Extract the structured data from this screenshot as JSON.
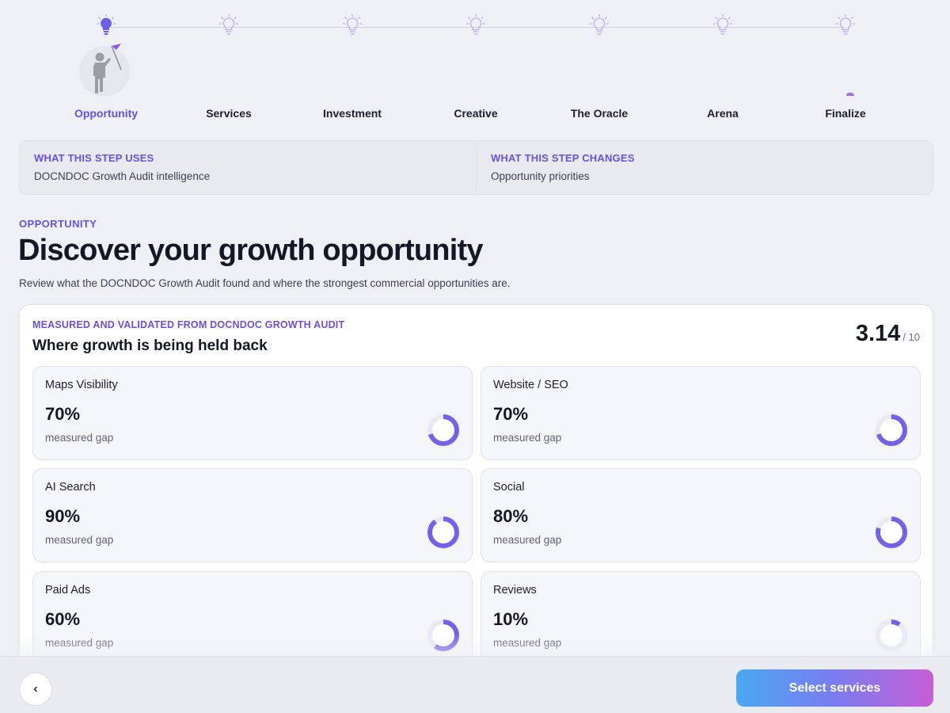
{
  "steps": [
    {
      "label": "Opportunity",
      "active": true
    },
    {
      "label": "Services",
      "active": false
    },
    {
      "label": "Investment",
      "active": false
    },
    {
      "label": "Creative",
      "active": false
    },
    {
      "label": "The Oracle",
      "active": false
    },
    {
      "label": "Arena",
      "active": false
    },
    {
      "label": "Finalize",
      "active": false
    }
  ],
  "info": {
    "uses_key": "WHAT THIS STEP USES",
    "uses_value": "DOCNDOC Growth Audit intelligence",
    "changes_key": "WHAT THIS STEP CHANGES",
    "changes_value": "Opportunity priorities"
  },
  "header": {
    "eyebrow": "OPPORTUNITY",
    "title": "Discover your growth opportunity",
    "subtitle": "Review what the DOCNDOC Growth Audit found and where the strongest commercial opportunities are."
  },
  "card": {
    "overline": "MEASURED AND VALIDATED FROM DOCNDOC GROWTH AUDIT",
    "heading": "Where growth is being held back",
    "score": "3.14",
    "score_denominator": "/ 10"
  },
  "metrics": [
    {
      "name": "Maps Visibility",
      "pct": "70%",
      "value": 0.7,
      "sub": "measured gap"
    },
    {
      "name": "Website / SEO",
      "pct": "70%",
      "value": 0.7,
      "sub": "measured gap"
    },
    {
      "name": "AI Search",
      "pct": "90%",
      "value": 0.9,
      "sub": "measured gap"
    },
    {
      "name": "Social",
      "pct": "80%",
      "value": 0.8,
      "sub": "measured gap"
    },
    {
      "name": "Paid Ads",
      "pct": "60%",
      "value": 0.6,
      "sub": "measured gap"
    },
    {
      "name": "Reviews",
      "pct": "10%",
      "value": 0.1,
      "sub": "measured gap"
    }
  ],
  "footer": {
    "back_label": "‹",
    "next_label": "Select services"
  },
  "colors": {
    "accent": "#6a4fe0",
    "ring": "#7561e6",
    "ring_track": "#e9e8f4",
    "bulb_active": "#6f5fe8",
    "bulb_inactive": "#b7aef0"
  }
}
